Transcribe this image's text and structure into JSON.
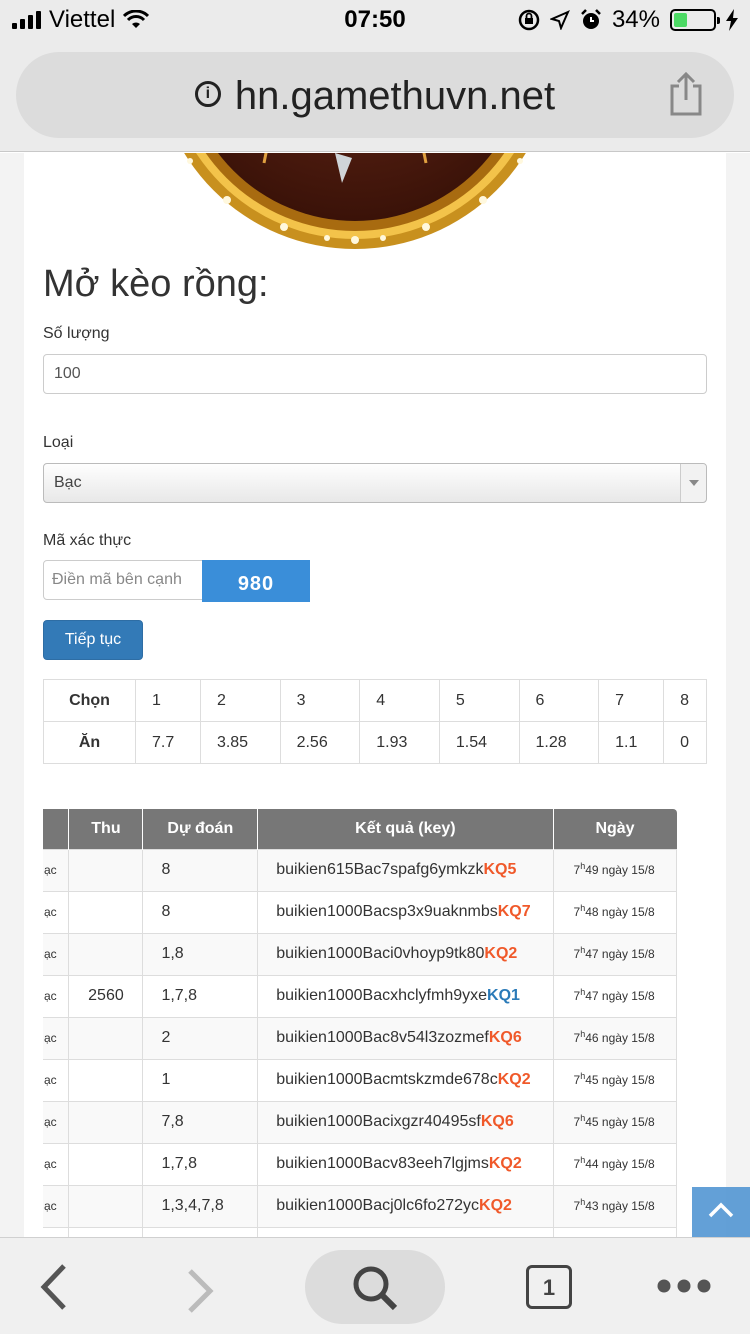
{
  "status_bar": {
    "carrier": "Viettel",
    "time": "07:50",
    "battery_percent": "34%",
    "battery_level": 0.34
  },
  "browser": {
    "url": "hn.gamethuvn.net"
  },
  "form": {
    "heading": "Mở kèo rồng:",
    "quantity_label": "Số lượng",
    "quantity_value": "100",
    "type_label": "Loại",
    "type_value": "Bạc",
    "captcha_label": "Mã xác thực",
    "captcha_placeholder": "Điền mã bên cạnh",
    "captcha_code": "980",
    "continue_label": "Tiếp tục"
  },
  "odds": {
    "choose_label": "Chọn",
    "win_label": "Ăn",
    "choices": [
      "1",
      "2",
      "3",
      "4",
      "5",
      "6",
      "7",
      "8"
    ],
    "payouts": [
      "7.7",
      "3.85",
      "2.56",
      "1.93",
      "1.54",
      "1.28",
      "1.1",
      "0"
    ]
  },
  "history": {
    "headers": [
      "Thu",
      "Dự đoán",
      "Kết quả (key)",
      "Ngày"
    ],
    "rows": [
      {
        "type": "ạc",
        "thu": "",
        "guess": "8",
        "key": "buikien615Bac7spafg6ymkzk",
        "kq": "KQ5",
        "kq_color": "red",
        "hour": "7",
        "rest": "49 ngày 15/8"
      },
      {
        "type": "ạc",
        "thu": "",
        "guess": "8",
        "key": "buikien1000Bacsp3x9uaknmbs",
        "kq": "KQ7",
        "kq_color": "red",
        "hour": "7",
        "rest": "48 ngày 15/8"
      },
      {
        "type": "ạc",
        "thu": "",
        "guess": "1,8",
        "key": "buikien1000Baci0vhoyp9tk80",
        "kq": "KQ2",
        "kq_color": "red",
        "hour": "7",
        "rest": "47 ngày 15/8"
      },
      {
        "type": "ạc",
        "thu": "2560",
        "guess": "1,7,8",
        "key": "buikien1000Bacxhclyfmh9yxe",
        "kq": "KQ1",
        "kq_color": "blue",
        "hour": "7",
        "rest": "47 ngày 15/8"
      },
      {
        "type": "ạc",
        "thu": "",
        "guess": "2",
        "key": "buikien1000Bac8v54l3zozmef",
        "kq": "KQ6",
        "kq_color": "red",
        "hour": "7",
        "rest": "46 ngày 15/8"
      },
      {
        "type": "ạc",
        "thu": "",
        "guess": "1",
        "key": "buikien1000Bacmtskzmde678c",
        "kq": "KQ2",
        "kq_color": "red",
        "hour": "7",
        "rest": "45 ngày 15/8"
      },
      {
        "type": "ạc",
        "thu": "",
        "guess": "7,8",
        "key": "buikien1000Bacixgzr40495sf",
        "kq": "KQ6",
        "kq_color": "red",
        "hour": "7",
        "rest": "45 ngày 15/8"
      },
      {
        "type": "ạc",
        "thu": "",
        "guess": "1,7,8",
        "key": "buikien1000Bacv83eeh7lgjms",
        "kq": "KQ2",
        "kq_color": "red",
        "hour": "7",
        "rest": "44 ngày 15/8"
      },
      {
        "type": "ạc",
        "thu": "",
        "guess": "1,3,4,7,8",
        "key": "buikien1000Bacj0lc6fo272yc",
        "kq": "KQ2",
        "kq_color": "red",
        "hour": "7",
        "rest": "43 ngày 15/8"
      },
      {
        "type": "",
        "thu": "",
        "guess": "",
        "key": "",
        "kq": "",
        "kq_color": "red",
        "hour": "",
        "rest": ""
      }
    ]
  },
  "bottom_bar": {
    "tab_count": "1"
  },
  "colors": {
    "primary_button": "#337ab7",
    "captcha_bg": "#3a8ed9",
    "kq_red": "#f0592a",
    "kq_blue": "#2a7ab8",
    "table_header": "#777777"
  }
}
